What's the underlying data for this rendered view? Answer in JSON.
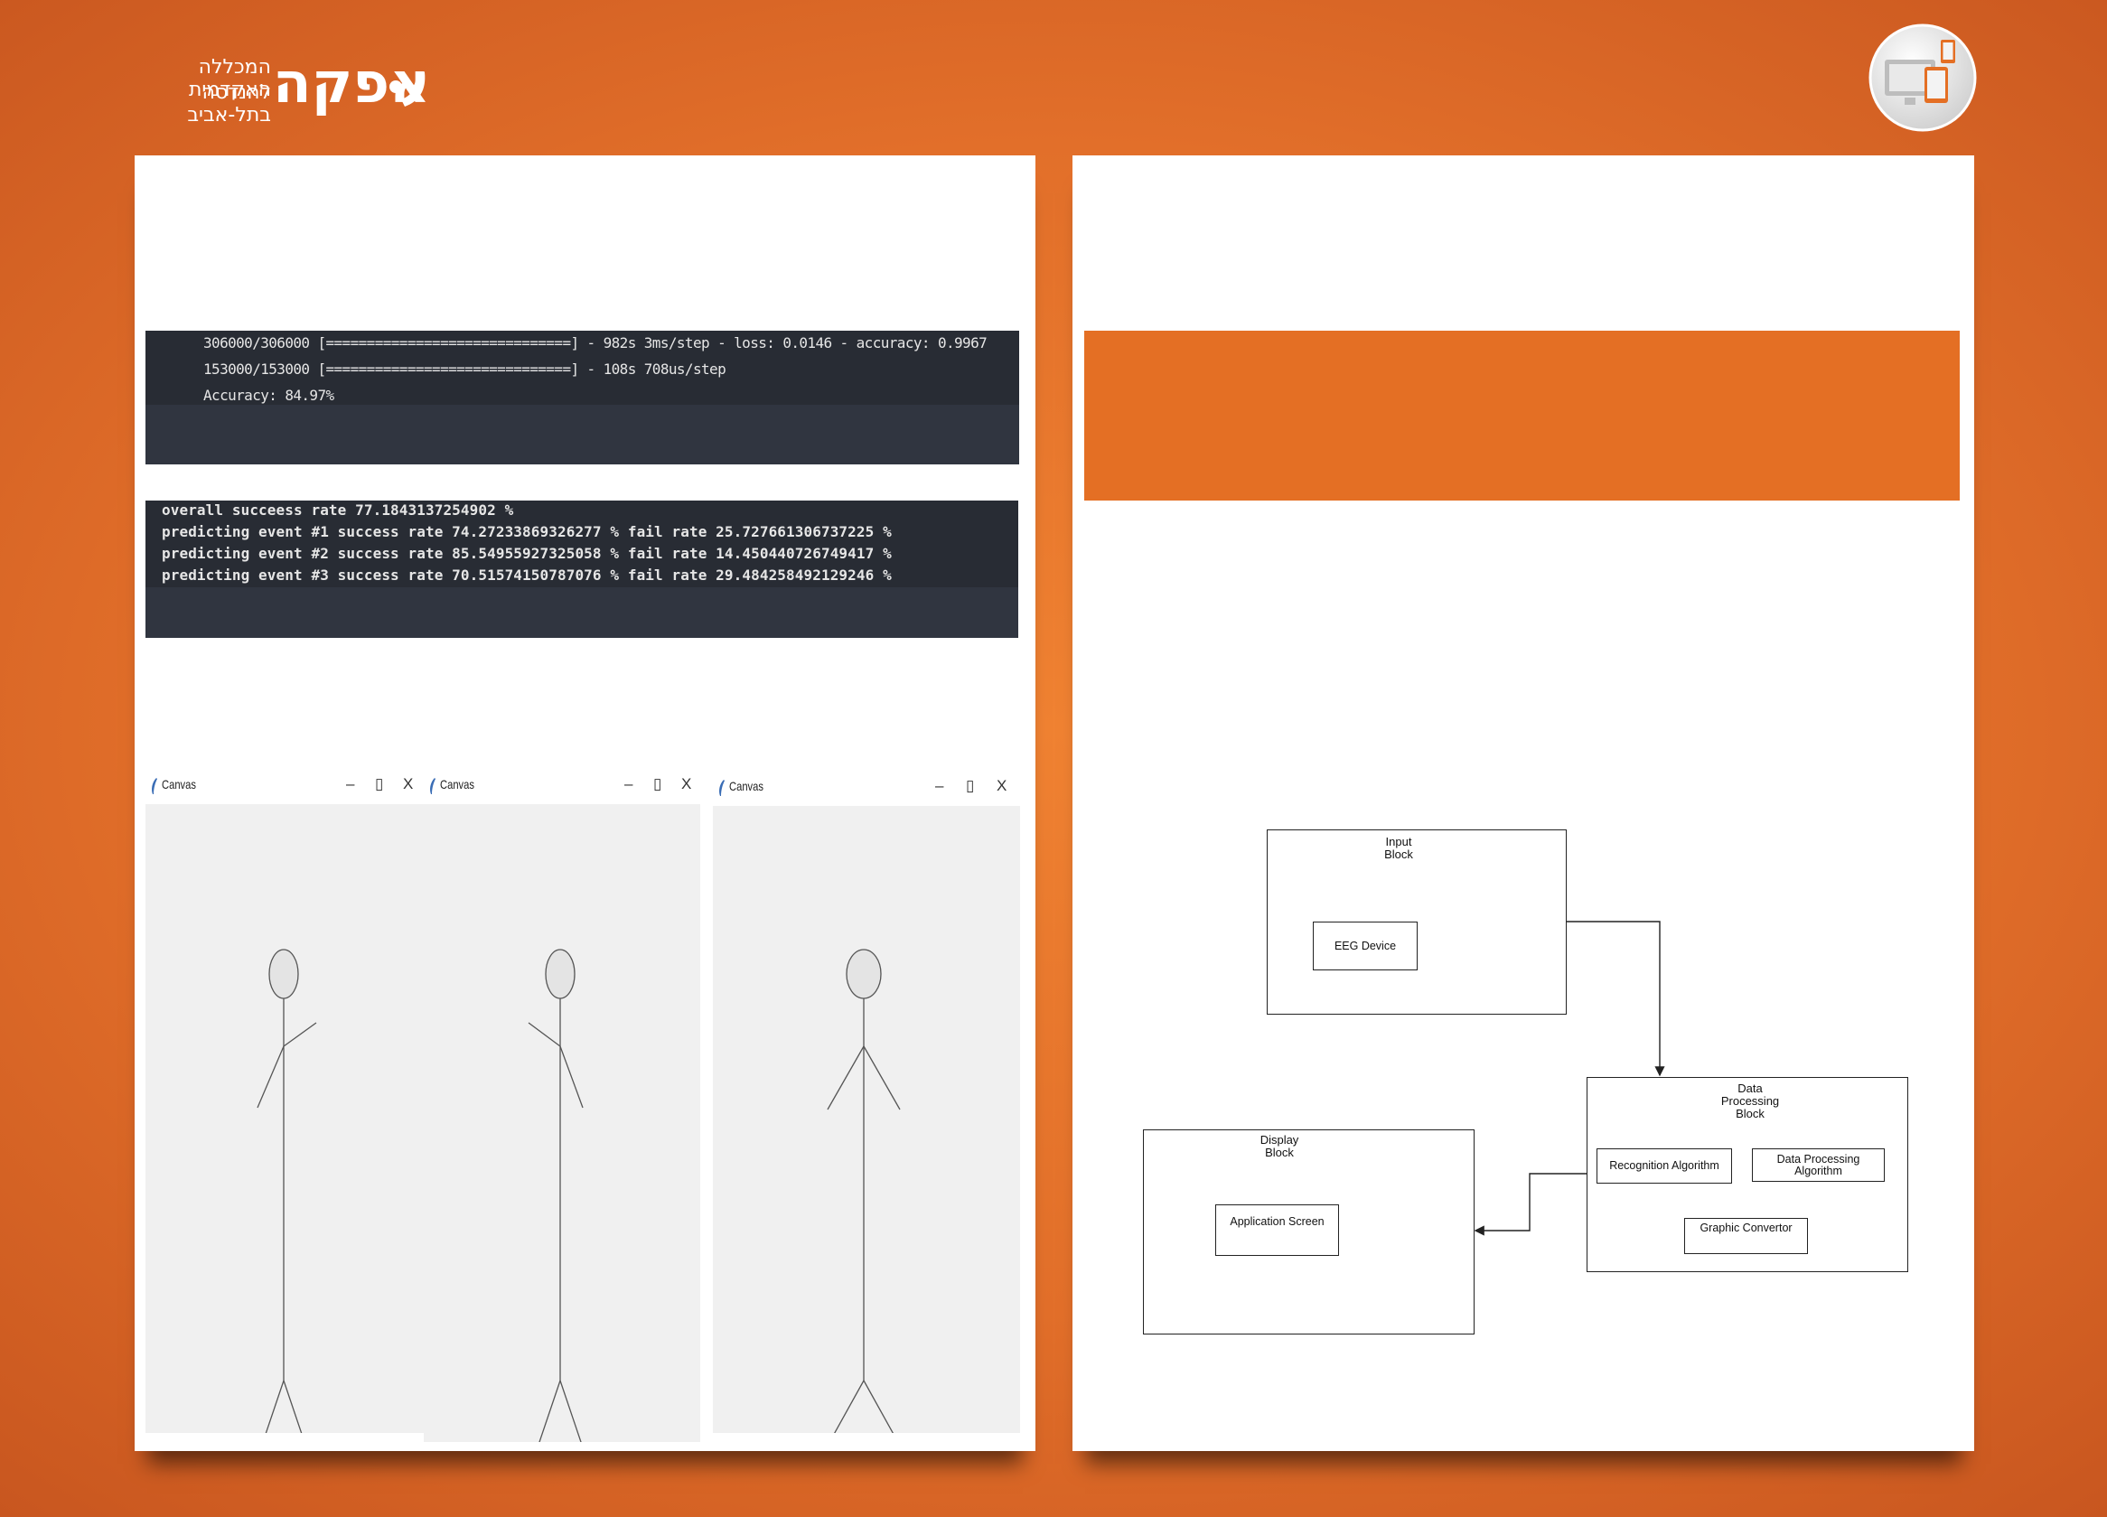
{
  "logo": {
    "line1": "המכללה האקדמית",
    "line2": "להנדסה בתל-אביב",
    "wordmark": "אפקה",
    "accent_color": "#e46f24"
  },
  "corner_icon": {
    "name": "devices-icon"
  },
  "terminal_training": {
    "lines": [
      "306000/306000 [==============================] - 982s 3ms/step - loss: 0.0146 - accuracy: 0.9967",
      "153000/153000 [==============================] - 108s 708us/step",
      "Accuracy: 84.97%"
    ]
  },
  "terminal_results": {
    "lines": [
      "overall succeess rate 77.1843137254902 %",
      "predicting event #1 success rate 74.27233869326277 % fail rate 25.727661306737225 %",
      "predicting event #2 success rate 85.54955927325058 % fail rate 14.450440726749417 %",
      "predicting event #3 success rate 70.51574150787076 % fail rate 29.484258492129246 %"
    ]
  },
  "canvas_windows": [
    {
      "title": "Canvas",
      "minimize": "–",
      "maximize": "▯",
      "close": "X",
      "pose": "right-arm-raised"
    },
    {
      "title": "Canvas",
      "minimize": "–",
      "maximize": "▯",
      "close": "X",
      "pose": "left-arm-raised"
    },
    {
      "title": "Canvas",
      "minimize": "–",
      "maximize": "▯",
      "close": "X",
      "pose": "neutral"
    }
  ],
  "diagram": {
    "input_block": {
      "title_l1": "Input",
      "title_l2": "Block",
      "items": [
        "EEG Device"
      ]
    },
    "data_block": {
      "title_l1": "Data",
      "title_l2": "Processing",
      "title_l3": "Block",
      "items": [
        "Recognition Algorithm",
        "Data Processing Algorithm",
        "Graphic Convertor"
      ]
    },
    "display_block": {
      "title_l1": "Display",
      "title_l2": "Block",
      "items": [
        "Application Screen"
      ]
    }
  }
}
